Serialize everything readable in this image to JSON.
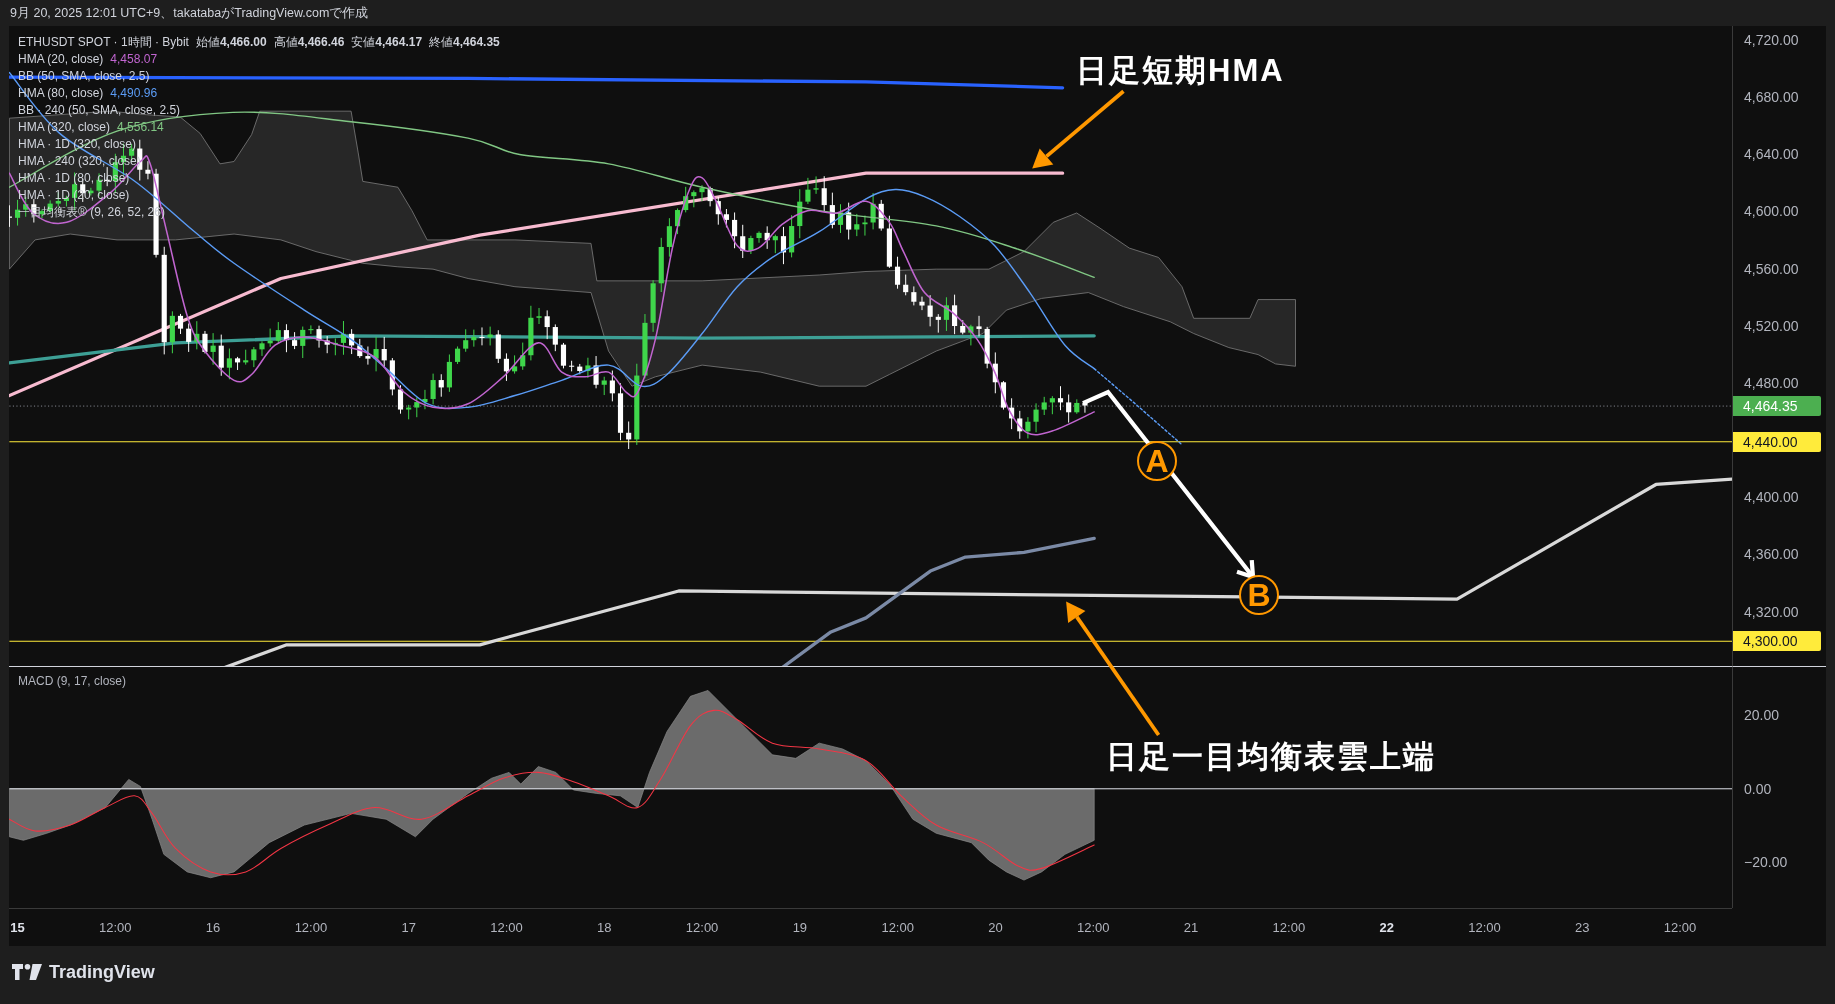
{
  "header": {
    "caption": "9月 20, 2025 12:01 UTC+9、takatabaがTradingView.comで作成"
  },
  "chart": {
    "legend": {
      "symbol": "ETHUSDT SPOT · 1時間 · Bybit",
      "ohlc": [
        "始値**4,466.00**",
        "高値**4,466.46**",
        "安値**4,464.17**",
        "終値**4,464.35**"
      ],
      "indicators": [
        {
          "name": "HMA (20, close)",
          "value": "4,458.07",
          "color": "#c165d0"
        },
        {
          "name": "BB (50, SMA, close, 2.5)"
        },
        {
          "name": "HMA (80, close)",
          "value": "4,490.96",
          "color": "#5b9cf6"
        },
        {
          "name": "BB · 240 (50, SMA, close, 2.5)"
        },
        {
          "name": "HMA (320, close)",
          "value": "4,556.14",
          "color": "#81c784"
        },
        {
          "name": "HMA · 1D (320, close)"
        },
        {
          "name": "HMA · 240 (320, close)"
        },
        {
          "name": "HMA · 1D (80, close)"
        },
        {
          "name": "HMA · 1D (20, close)"
        },
        {
          "name": "一目均衡表® (9, 26, 52, 26)"
        }
      ]
    },
    "annotations": [
      {
        "kind": "label",
        "text": "日足短期HMA"
      },
      {
        "kind": "marker",
        "text": "A"
      },
      {
        "kind": "marker",
        "text": "B"
      },
      {
        "kind": "label",
        "text": "日足一目均衡表雲上端"
      }
    ],
    "price_axis": {
      "ticks": [
        "4,720.00",
        "4,680.00",
        "4,640.00",
        "4,600.00",
        "4,560.00",
        "4,520.00",
        "4,480.00",
        "4,400.00",
        "4,360.00",
        "4,320.00"
      ],
      "tags": [
        {
          "text": "4,464.35",
          "color": "#4caf50"
        },
        {
          "text": "4,440.00",
          "color": "#ffeb3b"
        },
        {
          "text": "4,300.00",
          "color": "#ffeb3b"
        }
      ]
    },
    "macd": {
      "title": "MACD (9, 17, close)",
      "ticks": [
        "20.00",
        "0.00",
        "−20.00"
      ]
    },
    "time_axis": [
      {
        "label": "15",
        "emphasis": true
      },
      {
        "label": "12:00",
        "emphasis": false
      },
      {
        "label": "16",
        "emphasis": false
      },
      {
        "label": "12:00",
        "emphasis": false
      },
      {
        "label": "17",
        "emphasis": false
      },
      {
        "label": "12:00",
        "emphasis": false
      },
      {
        "label": "18",
        "emphasis": false
      },
      {
        "label": "12:00",
        "emphasis": false
      },
      {
        "label": "19",
        "emphasis": false
      },
      {
        "label": "12:00",
        "emphasis": false
      },
      {
        "label": "20",
        "emphasis": false
      },
      {
        "label": "12:00",
        "emphasis": false
      },
      {
        "label": "21",
        "emphasis": false
      },
      {
        "label": "12:00",
        "emphasis": false
      },
      {
        "label": "22",
        "emphasis": true
      },
      {
        "label": "12:00",
        "emphasis": false
      },
      {
        "label": "23",
        "emphasis": false
      },
      {
        "label": "12:00",
        "emphasis": false
      }
    ]
  },
  "footer": {
    "brand": "TradingView"
  }
}
